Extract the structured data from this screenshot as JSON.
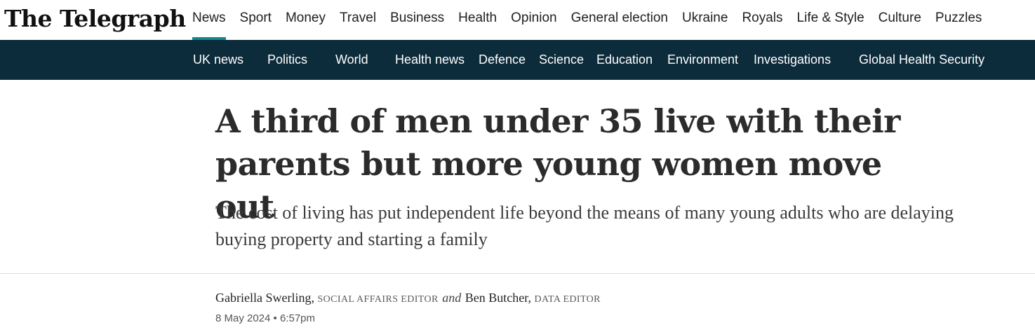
{
  "brand": {
    "logo_text": "The Telegraph"
  },
  "main_nav": [
    {
      "label": "News",
      "active": true
    },
    {
      "label": "Sport"
    },
    {
      "label": "Money"
    },
    {
      "label": "Travel"
    },
    {
      "label": "Business"
    },
    {
      "label": "Health"
    },
    {
      "label": "Opinion"
    },
    {
      "label": "General election"
    },
    {
      "label": "Ukraine"
    },
    {
      "label": "Royals"
    },
    {
      "label": "Life & Style"
    },
    {
      "label": "Culture"
    },
    {
      "label": "Puzzles"
    }
  ],
  "section_nav": [
    {
      "label": "UK news"
    },
    {
      "label": "Politics"
    },
    {
      "label": "World"
    },
    {
      "label": "Health news"
    },
    {
      "label": "Defence"
    },
    {
      "label": "Science"
    },
    {
      "label": "Education"
    },
    {
      "label": "Environment"
    },
    {
      "label": "Investigations"
    },
    {
      "label": "Global Health Security"
    }
  ],
  "article": {
    "headline": "A third of men under 35 live with their parents but more young women move out",
    "standfirst": "The cost of living has put independent life beyond the means of many young adults who are delaying buying property and starting a family",
    "byline": {
      "author1": "Gabriella Swerling",
      "role1": "Social Affairs Editor",
      "conjunction": "and",
      "author2": "Ben Butcher",
      "role2": "Data Editor"
    },
    "date": "8 May 2024 • 6:57pm"
  },
  "colors": {
    "accent": "#108a8d",
    "section_bar": "#0c2b3b",
    "headline_text": "#2b2b2b"
  }
}
